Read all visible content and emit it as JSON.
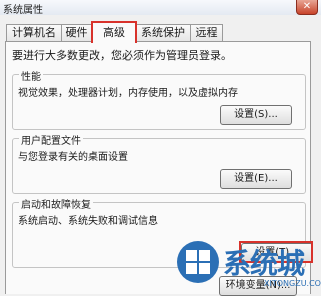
{
  "window": {
    "title": "系统属性",
    "close_glyph": "✕"
  },
  "tabs": [
    {
      "label": "计算机名",
      "active": false
    },
    {
      "label": "硬件",
      "active": false
    },
    {
      "label": "高级",
      "active": true
    },
    {
      "label": "系统保护",
      "active": false
    },
    {
      "label": "远程",
      "active": false
    }
  ],
  "notice": "要进行大多数更改，您必须作为管理员登录。",
  "groups": {
    "performance": {
      "title": "性能",
      "desc": "视觉效果，处理器计划，内存使用，以及虚拟内存",
      "button": "设置(S)..."
    },
    "user_profiles": {
      "title": "用户配置文件",
      "desc": "与您登录有关的桌面设置",
      "button": "设置(E)..."
    },
    "startup_recovery": {
      "title": "启动和故障恢复",
      "desc": "系统启动、系统失败和调试信息",
      "button": "设置(T)...",
      "env_button": "环境变量(N)..."
    }
  },
  "watermark": {
    "brand": "系统城",
    "url": "XITONGZU.COM"
  },
  "colors": {
    "highlight": "#d8322b",
    "brand_blue": "#2b6fb5"
  }
}
